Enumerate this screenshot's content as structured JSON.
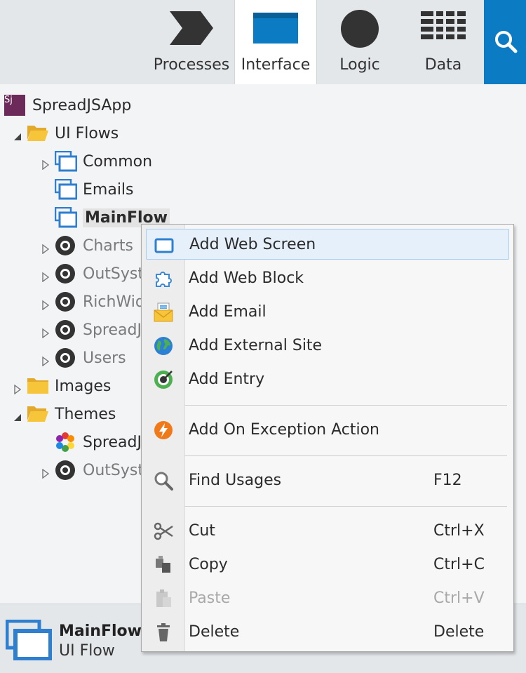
{
  "tabs": [
    {
      "label": "Processes",
      "icon": "processes-chevron-icon"
    },
    {
      "label": "Interface",
      "icon": "interface-window-icon",
      "active": true
    },
    {
      "label": "Logic",
      "icon": "logic-circle-icon"
    },
    {
      "label": "Data",
      "icon": "data-grid-icon"
    }
  ],
  "tree": {
    "app": {
      "label": "SpreadJSApp",
      "badge": "Sj"
    },
    "ui_flows": {
      "label": "UI Flows"
    },
    "flows": [
      {
        "label": "Common"
      },
      {
        "label": "Emails"
      },
      {
        "label": "MainFlow"
      }
    ],
    "modules": [
      {
        "label": "Charts"
      },
      {
        "label": "OutSyst"
      },
      {
        "label": "RichWid"
      },
      {
        "label": "SpreadJ"
      },
      {
        "label": "Users"
      }
    ],
    "images": {
      "label": "Images"
    },
    "themes": {
      "label": "Themes"
    },
    "theme_items": [
      {
        "label": "SpreadJ"
      },
      {
        "label": "OutSyst"
      }
    ]
  },
  "status": {
    "title": "MainFlow",
    "subtitle": "UI Flow"
  },
  "menu": {
    "items": [
      {
        "label": "Add Web Screen",
        "shortcut": "",
        "icon": "web-screen-icon"
      },
      {
        "label": "Add Web Block",
        "shortcut": "",
        "icon": "web-block-icon"
      },
      {
        "label": "Add Email",
        "shortcut": "",
        "icon": "email-icon"
      },
      {
        "label": "Add External Site",
        "shortcut": "",
        "icon": "globe-icon"
      },
      {
        "label": "Add Entry",
        "shortcut": "",
        "icon": "entry-icon"
      },
      {
        "label": "Add On Exception Action",
        "shortcut": "",
        "icon": "exception-icon"
      },
      {
        "label": "Find Usages",
        "shortcut": "F12",
        "icon": "magnifier-icon"
      },
      {
        "label": "Cut",
        "shortcut": "Ctrl+X",
        "icon": "scissors-icon"
      },
      {
        "label": "Copy",
        "shortcut": "Ctrl+C",
        "icon": "copy-icon"
      },
      {
        "label": "Paste",
        "shortcut": "Ctrl+V",
        "icon": "paste-icon",
        "disabled": true
      },
      {
        "label": "Delete",
        "shortcut": "Delete",
        "icon": "trash-icon"
      }
    ]
  },
  "colors": {
    "accent": "#0b7cc4",
    "app_badge": "#6b2a5a",
    "highlight": "#e6f0fb",
    "folder": "#f7c53a",
    "exception": "#f07a1a"
  }
}
